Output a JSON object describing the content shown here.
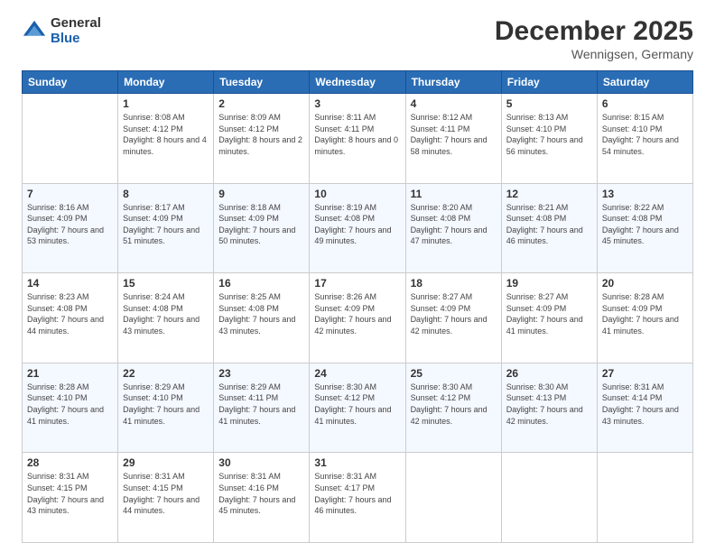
{
  "header": {
    "logo_general": "General",
    "logo_blue": "Blue",
    "month_title": "December 2025",
    "location": "Wennigsen, Germany"
  },
  "weekdays": [
    "Sunday",
    "Monday",
    "Tuesday",
    "Wednesday",
    "Thursday",
    "Friday",
    "Saturday"
  ],
  "weeks": [
    [
      {
        "day": "",
        "sunrise": "",
        "sunset": "",
        "daylight": ""
      },
      {
        "day": "1",
        "sunrise": "8:08 AM",
        "sunset": "4:12 PM",
        "daylight": "8 hours and 4 minutes."
      },
      {
        "day": "2",
        "sunrise": "8:09 AM",
        "sunset": "4:12 PM",
        "daylight": "8 hours and 2 minutes."
      },
      {
        "day": "3",
        "sunrise": "8:11 AM",
        "sunset": "4:11 PM",
        "daylight": "8 hours and 0 minutes."
      },
      {
        "day": "4",
        "sunrise": "8:12 AM",
        "sunset": "4:11 PM",
        "daylight": "7 hours and 58 minutes."
      },
      {
        "day": "5",
        "sunrise": "8:13 AM",
        "sunset": "4:10 PM",
        "daylight": "7 hours and 56 minutes."
      },
      {
        "day": "6",
        "sunrise": "8:15 AM",
        "sunset": "4:10 PM",
        "daylight": "7 hours and 54 minutes."
      }
    ],
    [
      {
        "day": "7",
        "sunrise": "8:16 AM",
        "sunset": "4:09 PM",
        "daylight": "7 hours and 53 minutes."
      },
      {
        "day": "8",
        "sunrise": "8:17 AM",
        "sunset": "4:09 PM",
        "daylight": "7 hours and 51 minutes."
      },
      {
        "day": "9",
        "sunrise": "8:18 AM",
        "sunset": "4:09 PM",
        "daylight": "7 hours and 50 minutes."
      },
      {
        "day": "10",
        "sunrise": "8:19 AM",
        "sunset": "4:08 PM",
        "daylight": "7 hours and 49 minutes."
      },
      {
        "day": "11",
        "sunrise": "8:20 AM",
        "sunset": "4:08 PM",
        "daylight": "7 hours and 47 minutes."
      },
      {
        "day": "12",
        "sunrise": "8:21 AM",
        "sunset": "4:08 PM",
        "daylight": "7 hours and 46 minutes."
      },
      {
        "day": "13",
        "sunrise": "8:22 AM",
        "sunset": "4:08 PM",
        "daylight": "7 hours and 45 minutes."
      }
    ],
    [
      {
        "day": "14",
        "sunrise": "8:23 AM",
        "sunset": "4:08 PM",
        "daylight": "7 hours and 44 minutes."
      },
      {
        "day": "15",
        "sunrise": "8:24 AM",
        "sunset": "4:08 PM",
        "daylight": "7 hours and 43 minutes."
      },
      {
        "day": "16",
        "sunrise": "8:25 AM",
        "sunset": "4:08 PM",
        "daylight": "7 hours and 43 minutes."
      },
      {
        "day": "17",
        "sunrise": "8:26 AM",
        "sunset": "4:09 PM",
        "daylight": "7 hours and 42 minutes."
      },
      {
        "day": "18",
        "sunrise": "8:27 AM",
        "sunset": "4:09 PM",
        "daylight": "7 hours and 42 minutes."
      },
      {
        "day": "19",
        "sunrise": "8:27 AM",
        "sunset": "4:09 PM",
        "daylight": "7 hours and 41 minutes."
      },
      {
        "day": "20",
        "sunrise": "8:28 AM",
        "sunset": "4:09 PM",
        "daylight": "7 hours and 41 minutes."
      }
    ],
    [
      {
        "day": "21",
        "sunrise": "8:28 AM",
        "sunset": "4:10 PM",
        "daylight": "7 hours and 41 minutes."
      },
      {
        "day": "22",
        "sunrise": "8:29 AM",
        "sunset": "4:10 PM",
        "daylight": "7 hours and 41 minutes."
      },
      {
        "day": "23",
        "sunrise": "8:29 AM",
        "sunset": "4:11 PM",
        "daylight": "7 hours and 41 minutes."
      },
      {
        "day": "24",
        "sunrise": "8:30 AM",
        "sunset": "4:12 PM",
        "daylight": "7 hours and 41 minutes."
      },
      {
        "day": "25",
        "sunrise": "8:30 AM",
        "sunset": "4:12 PM",
        "daylight": "7 hours and 42 minutes."
      },
      {
        "day": "26",
        "sunrise": "8:30 AM",
        "sunset": "4:13 PM",
        "daylight": "7 hours and 42 minutes."
      },
      {
        "day": "27",
        "sunrise": "8:31 AM",
        "sunset": "4:14 PM",
        "daylight": "7 hours and 43 minutes."
      }
    ],
    [
      {
        "day": "28",
        "sunrise": "8:31 AM",
        "sunset": "4:15 PM",
        "daylight": "7 hours and 43 minutes."
      },
      {
        "day": "29",
        "sunrise": "8:31 AM",
        "sunset": "4:15 PM",
        "daylight": "7 hours and 44 minutes."
      },
      {
        "day": "30",
        "sunrise": "8:31 AM",
        "sunset": "4:16 PM",
        "daylight": "7 hours and 45 minutes."
      },
      {
        "day": "31",
        "sunrise": "8:31 AM",
        "sunset": "4:17 PM",
        "daylight": "7 hours and 46 minutes."
      },
      {
        "day": "",
        "sunrise": "",
        "sunset": "",
        "daylight": ""
      },
      {
        "day": "",
        "sunrise": "",
        "sunset": "",
        "daylight": ""
      },
      {
        "day": "",
        "sunrise": "",
        "sunset": "",
        "daylight": ""
      }
    ]
  ]
}
